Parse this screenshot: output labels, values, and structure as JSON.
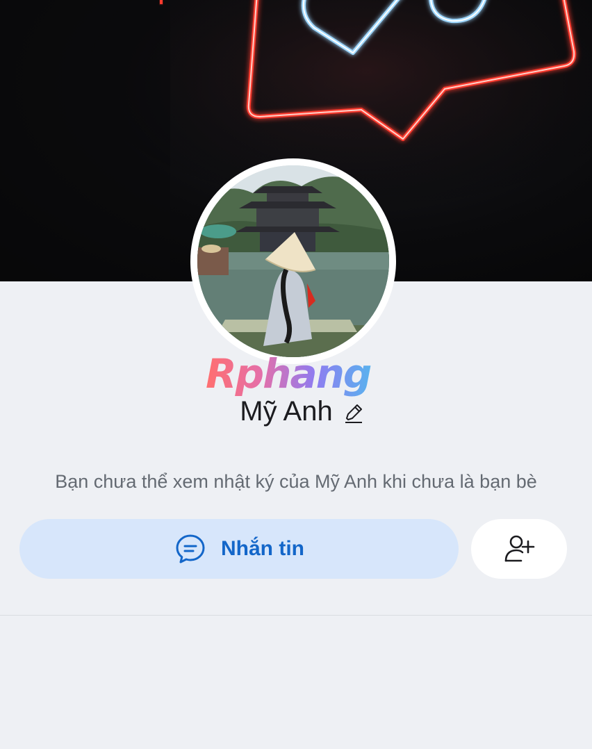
{
  "profile": {
    "name": "Mỹ Anh",
    "notice": "Bạn chưa thể xem nhật ký của Mỹ Anh khi chưa là bạn bè"
  },
  "watermark": "Rphang",
  "actions": {
    "message_label": "Nhắn tin",
    "message_icon": "chat-bubble-icon",
    "add_friend_icon": "add-friend-icon",
    "edit_icon": "pencil-icon"
  },
  "colors": {
    "accent": "#1366c9",
    "message_button_bg": "#d7e6fb",
    "background": "#eef0f4",
    "neon_red": "#ff3b2f",
    "neon_blue": "#9fd8ff"
  }
}
